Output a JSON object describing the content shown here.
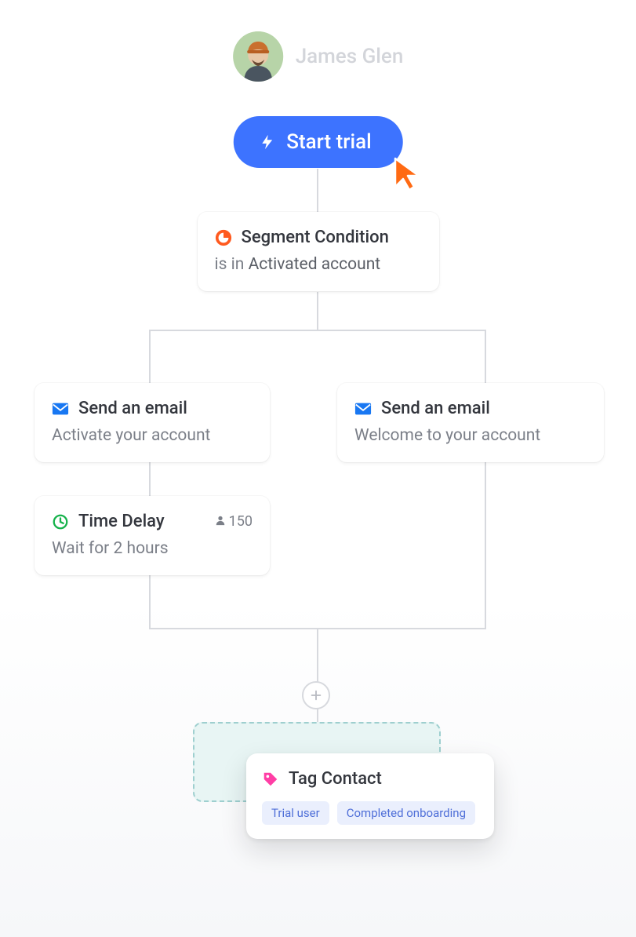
{
  "user": {
    "name": "James Glen"
  },
  "start_button": {
    "label": "Start trial"
  },
  "nodes": {
    "segment": {
      "title": "Segment Condition",
      "subtitle_prefix": "is in ",
      "subtitle_value": "Activated account"
    },
    "email_left": {
      "title": "Send an email",
      "subtitle": "Activate your account"
    },
    "email_right": {
      "title": "Send an email",
      "subtitle": "Welcome to your account"
    },
    "delay": {
      "title": "Time Delay",
      "subtitle": "Wait for 2 hours",
      "count": "150"
    },
    "tag": {
      "title": "Tag Contact",
      "chips": [
        "Trial user",
        "Completed onboarding"
      ]
    }
  }
}
